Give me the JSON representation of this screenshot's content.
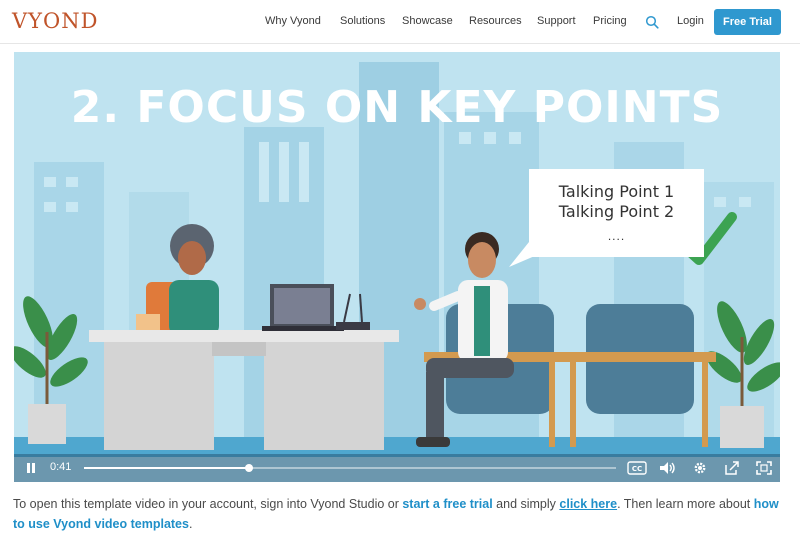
{
  "brand": {
    "logo_text": "VYOND",
    "color": "#c0542a"
  },
  "nav": {
    "items": [
      "Why Vyond",
      "Solutions",
      "Showcase",
      "Resources",
      "Support",
      "Pricing"
    ],
    "search_icon": "search-icon",
    "login_label": "Login",
    "cta_label": "Free Trial",
    "cta_color": "#2f98cf"
  },
  "video": {
    "title": "2. FOCUS ON KEY POINTS",
    "bubble_lines": [
      "Talking Point 1",
      "Talking Point 2"
    ],
    "bubble_dots": "....",
    "time": "0:41",
    "progress_fraction": 0.31,
    "controls": [
      "pause-icon",
      "cc-icon",
      "volume-icon",
      "settings-icon",
      "share-icon",
      "fullscreen-icon"
    ],
    "cc_label": "CC"
  },
  "caption": {
    "part1": "To open this template video in your account, sign into Vyond Studio or ",
    "link1": "start a free trial",
    "part2": " and simply ",
    "link2": "click here",
    "part3": ". Then learn more about ",
    "link3": "how to use Vyond video templates",
    "part4": ".",
    "link_color": "#1f8fc8"
  }
}
